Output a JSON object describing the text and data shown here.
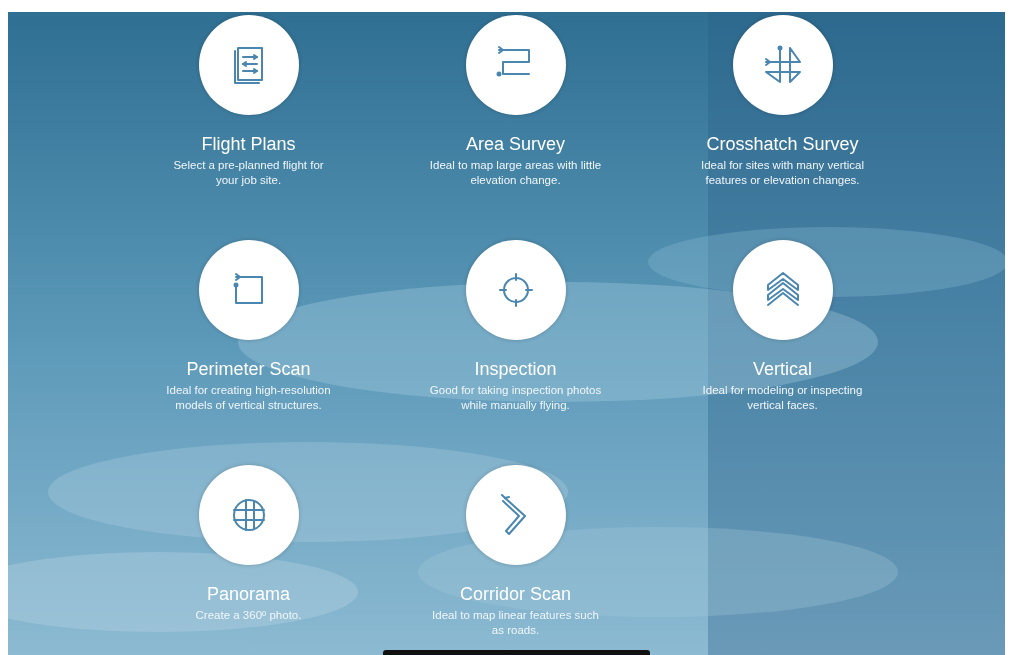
{
  "modes": [
    {
      "title": "Flight Plans",
      "description": "Select a pre-planned flight for your job site."
    },
    {
      "title": "Area Survey",
      "description": "Ideal to map large areas with little elevation change."
    },
    {
      "title": "Crosshatch Survey",
      "description": "Ideal for sites with many vertical features or elevation changes."
    },
    {
      "title": "Perimeter Scan",
      "description": "Ideal for creating high-resolution models of vertical structures."
    },
    {
      "title": "Inspection",
      "description": "Good for taking inspection photos while manually flying."
    },
    {
      "title": "Vertical",
      "description": "Ideal for modeling or inspecting vertical faces."
    },
    {
      "title": "Panorama",
      "description": "Create a 360º photo."
    },
    {
      "title": "Corridor Scan",
      "description": "Ideal to map linear features such as roads."
    }
  ]
}
